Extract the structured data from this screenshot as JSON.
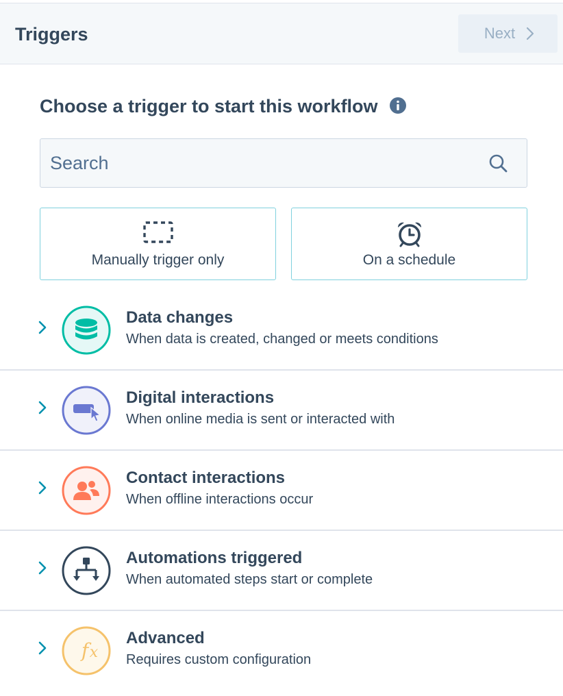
{
  "header": {
    "title": "Triggers",
    "next_label": "Next"
  },
  "main": {
    "prompt": "Choose a trigger to start this workflow",
    "search": {
      "placeholder": "Search",
      "value": ""
    },
    "quick_triggers": [
      {
        "label": "Manually trigger only",
        "icon": "dashed-square-icon"
      },
      {
        "label": "On a schedule",
        "icon": "alarm-clock-icon"
      }
    ],
    "categories": [
      {
        "title": "Data changes",
        "description": "When data is created, changed or meets conditions",
        "icon": "database-icon",
        "color": "#00bda5"
      },
      {
        "title": "Digital interactions",
        "description": "When online media is sent or interacted with",
        "icon": "cursor-click-icon",
        "color": "#6a78d1"
      },
      {
        "title": "Contact interactions",
        "description": "When offline interactions occur",
        "icon": "contacts-icon",
        "color": "#ff7a59"
      },
      {
        "title": "Automations triggered",
        "description": "When automated steps start or complete",
        "icon": "workflow-icon",
        "color": "#33475b"
      },
      {
        "title": "Advanced",
        "description": "Requires custom configuration",
        "icon": "function-icon",
        "color": "#f5c26b"
      }
    ]
  },
  "colors": {
    "accent_teal": "#0091ae",
    "text": "#33475b",
    "border": "#dfe3eb"
  }
}
